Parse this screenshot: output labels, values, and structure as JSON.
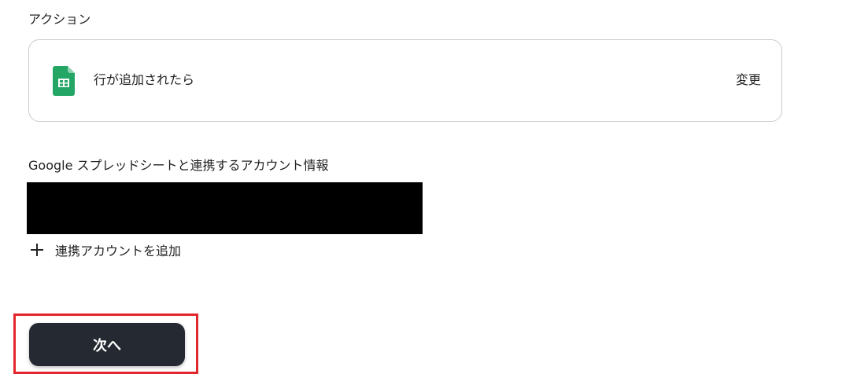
{
  "action_section": {
    "title": "アクション",
    "card": {
      "icon": "google-sheets-icon",
      "label": "行が追加されたら",
      "change_label": "変更"
    }
  },
  "account_section": {
    "title": "Google スプレッドシートと連携するアカウント情報",
    "add_account_label": "連携アカウントを追加",
    "add_icon": "plus-icon"
  },
  "footer": {
    "next_label": "次へ"
  },
  "colors": {
    "sheets_green": "#23A566",
    "button_dark": "#252932",
    "highlight_red": "#E3262B"
  }
}
